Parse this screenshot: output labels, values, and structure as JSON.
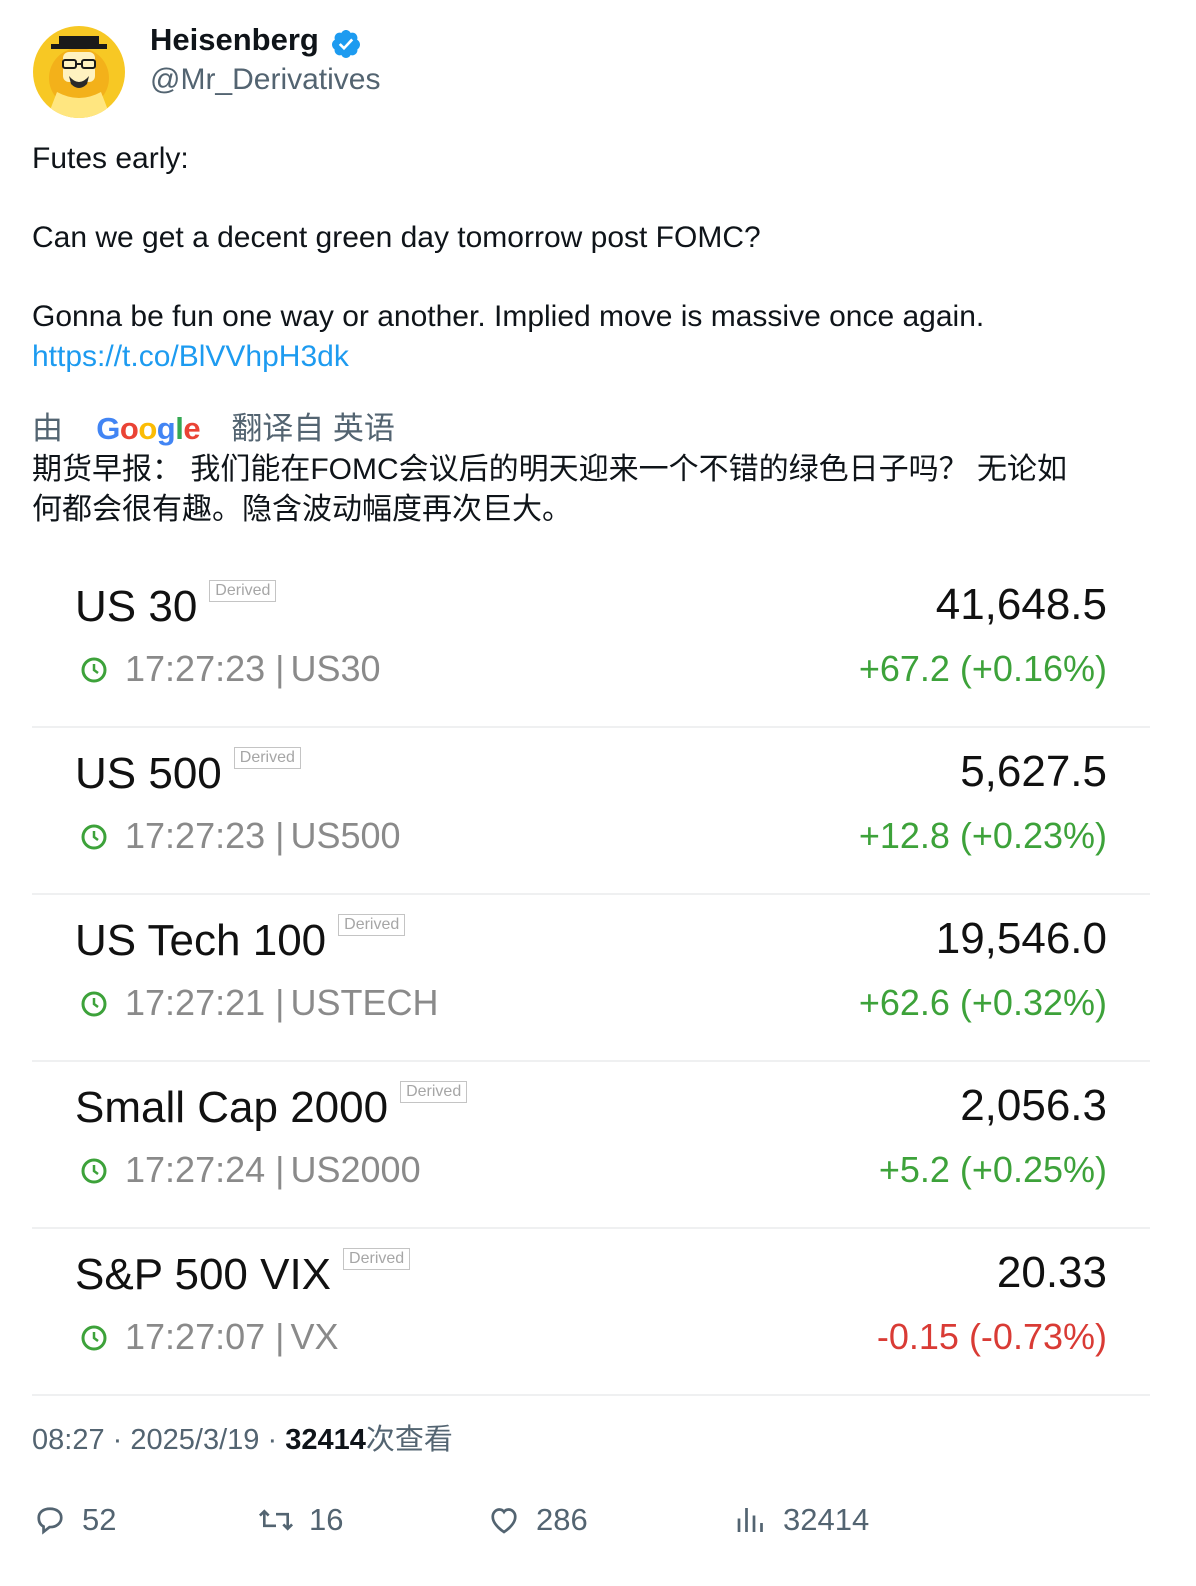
{
  "author": {
    "display_name": "Heisenberg",
    "handle": "@Mr_Derivatives",
    "verified_icon": "verified-badge-icon"
  },
  "tweet": {
    "line1": "Futes early:",
    "line2": "Can we get a decent green day tomorrow post FOMC?",
    "line3": "Gonna be fun one way or another. Implied move is massive once again.",
    "link": "https://t.co/BlVVhpH3dk"
  },
  "translation": {
    "by": "由",
    "brand": "Google",
    "label": "翻译自 英语",
    "text_line1": "期货早报： 我们能在FOMC会议后的明天迎来一个不错的绿色日子吗？ 无论如",
    "text_line2": "何都会很有趣。隐含波动幅度再次巨大。"
  },
  "quotes": [
    {
      "name": "US 30",
      "badge": "Derived",
      "price": "41,648.5",
      "time": "17:27:23",
      "sep": "|",
      "symbol": "US30",
      "change": "+67.2 (+0.16%)",
      "direction": "up"
    },
    {
      "name": "US 500",
      "badge": "Derived",
      "price": "5,627.5",
      "time": "17:27:23",
      "sep": "|",
      "symbol": "US500",
      "change": "+12.8 (+0.23%)",
      "direction": "up"
    },
    {
      "name": "US Tech 100",
      "badge": "Derived",
      "price": "19,546.0",
      "time": "17:27:21",
      "sep": "|",
      "symbol": "USTECH",
      "change": "+62.6 (+0.32%)",
      "direction": "up"
    },
    {
      "name": "Small Cap 2000",
      "badge": "Derived",
      "price": "2,056.3",
      "time": "17:27:24",
      "sep": "|",
      "symbol": "US2000",
      "change": "+5.2 (+0.25%)",
      "direction": "up"
    },
    {
      "name": "S&P 500 VIX",
      "badge": "Derived",
      "price": "20.33",
      "time": "17:27:07",
      "sep": "|",
      "symbol": "VX",
      "change": "-0.15 (-0.73%)",
      "direction": "down"
    }
  ],
  "meta": {
    "time": "08:27",
    "dot1": "·",
    "date": "2025/3/19",
    "dot2": "·",
    "views": "32414",
    "views_label": "次查看"
  },
  "actions": {
    "replies": "52",
    "retweets": "16",
    "likes": "286",
    "views": "32414"
  },
  "colors": {
    "positive": "#3da23a",
    "negative": "#d93b35",
    "link": "#1d9bf0",
    "verified": "#1d9bf0",
    "clock": "#3da23a"
  }
}
